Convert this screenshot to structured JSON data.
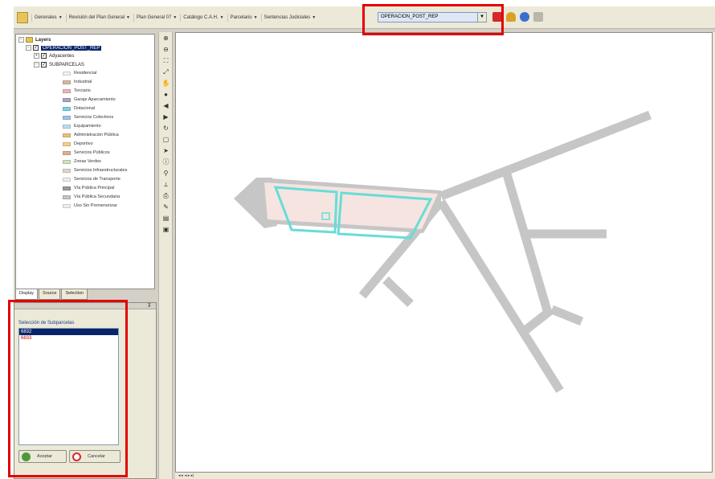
{
  "toolbar": {
    "menus": [
      "Generales",
      "Revisión del Plan General",
      "Plan General 07",
      "Catálogo C.A.H.",
      "Parcelario",
      "Sentencias Judiciales"
    ],
    "layer_combo_value": "OPERACION_POST_REP"
  },
  "layers_tree": {
    "root_label": "Layers",
    "active_layer": "OPERACION_POST_REP",
    "sublayers": [
      "Adyacentes",
      "SUBPARCELAS"
    ],
    "legend": [
      {
        "label": "Residencial",
        "color": "#f4f0f0"
      },
      {
        "label": "Industrial",
        "color": "#d9b7a0"
      },
      {
        "label": "Terciario",
        "color": "#e6b8b8"
      },
      {
        "label": "Garaje Aparcamiento",
        "color": "#a9a6c0"
      },
      {
        "label": "Dotacional",
        "color": "#7fd3e6"
      },
      {
        "label": "Servicios Colectivos",
        "color": "#9fc3e8"
      },
      {
        "label": "Equipamiento",
        "color": "#b7ddf0"
      },
      {
        "label": "Administración Pública",
        "color": "#e8c27a"
      },
      {
        "label": "Deportivo",
        "color": "#f0d28a"
      },
      {
        "label": "Servicios Públicos",
        "color": "#e0b090"
      },
      {
        "label": "Zonas Verdes",
        "color": "#cfe2b8"
      },
      {
        "label": "Servicios Infraestructurales",
        "color": "#ddd8cc"
      },
      {
        "label": "Servicios de Transporte",
        "color": "#ecebe6"
      },
      {
        "label": "Vía Pública Principal",
        "color": "#9a9a9a"
      },
      {
        "label": "Vía Pública Secundaria",
        "color": "#c4c4c4"
      },
      {
        "label": "Uso Sin Pormenorizar",
        "color": "#eeeeee"
      }
    ]
  },
  "tabs": [
    "Display",
    "Source",
    "Selection"
  ],
  "subparcel_panel": {
    "title": "Selección de Subparcelas",
    "items": [
      {
        "label": "6832",
        "selected": true
      },
      {
        "label": "6833",
        "selected": false
      }
    ],
    "accept_label": "Aceptar",
    "cancel_label": "Cancelar"
  },
  "colors": {
    "road": "#c6c6c6",
    "parcel_fill": "#f6e4e0",
    "parcel_outline": "#66ddd8",
    "highlight_box": "#e30000",
    "selection": "#0a246a"
  }
}
